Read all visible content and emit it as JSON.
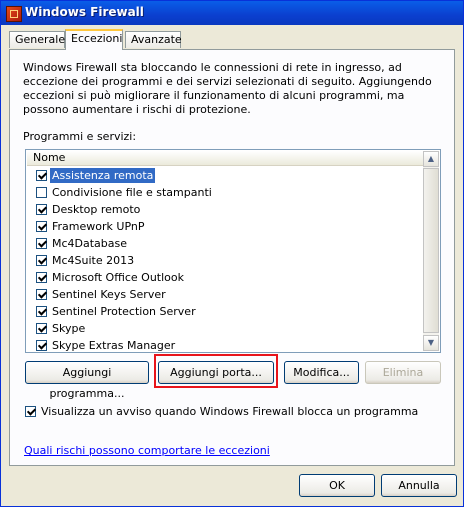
{
  "window": {
    "title": "Windows Firewall",
    "icon": "firewall-icon"
  },
  "tabs": [
    {
      "label": "Generale",
      "active": false
    },
    {
      "label": "Eccezioni",
      "active": true
    },
    {
      "label": "Avanzate",
      "active": false
    }
  ],
  "description": "Windows Firewall sta bloccando le connessioni di rete in ingresso, ad eccezione dei programmi e dei servizi selezionati di seguito. Aggiungendo eccezioni si può migliorare il funzionamento di alcuni programmi, ma possono aumentare i rischi di protezione.",
  "list": {
    "label": "Programmi e servizi:",
    "column_header": "Nome",
    "items": [
      {
        "label": "Assistenza remota",
        "checked": true,
        "selected": true
      },
      {
        "label": "Condivisione file e stampanti",
        "checked": false,
        "selected": false
      },
      {
        "label": "Desktop remoto",
        "checked": true,
        "selected": false
      },
      {
        "label": "Framework UPnP",
        "checked": true,
        "selected": false
      },
      {
        "label": "Mc4Database",
        "checked": true,
        "selected": false
      },
      {
        "label": "Mc4Suite 2013",
        "checked": true,
        "selected": false
      },
      {
        "label": "Microsoft Office Outlook",
        "checked": true,
        "selected": false
      },
      {
        "label": "Sentinel Keys Server",
        "checked": true,
        "selected": false
      },
      {
        "label": "Sentinel Protection Server",
        "checked": true,
        "selected": false
      },
      {
        "label": "Skype",
        "checked": true,
        "selected": false
      },
      {
        "label": "Skype Extras Manager",
        "checked": true,
        "selected": false
      }
    ]
  },
  "buttons": {
    "add_program": "Aggiungi programma...",
    "add_port": "Aggiungi porta...",
    "edit": "Modifica...",
    "delete": "Elimina"
  },
  "notify": {
    "label": "Visualizza un avviso quando Windows Firewall blocca un programma",
    "checked": true
  },
  "risk_link": "Quali rischi possono comportare le eccezioni",
  "footer": {
    "ok": "OK",
    "cancel": "Annulla"
  },
  "colors": {
    "highlight": "#e8141b",
    "selection": "#316ac5",
    "title_bar": "#0a5ee8"
  }
}
